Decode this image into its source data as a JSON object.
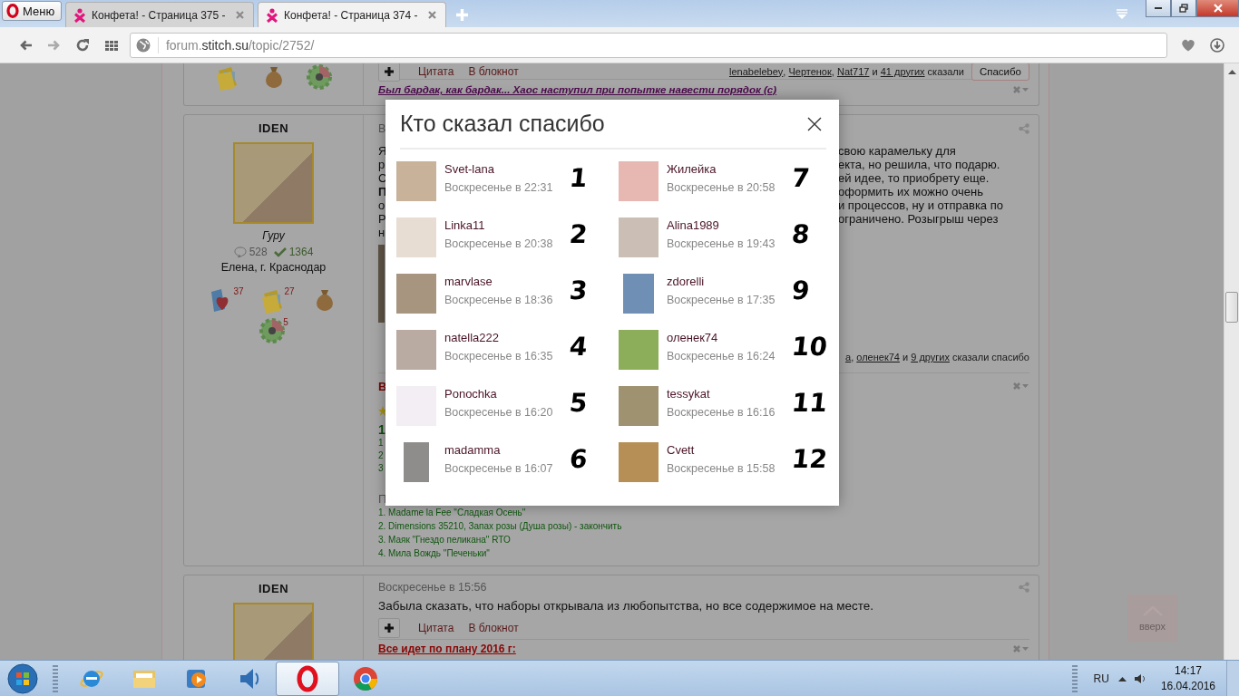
{
  "browser": {
    "menu_label": "Меню",
    "tabs": [
      {
        "title": "Конфета! - Страница 375 -",
        "selected": false
      },
      {
        "title": "Конфета! - Страница 374 -",
        "selected": true
      }
    ],
    "url": [
      {
        "kind": "dim",
        "text": "forum."
      },
      {
        "kind": "host",
        "text": "stitch.su"
      },
      {
        "kind": "dim",
        "text": "/topic/2752/"
      }
    ]
  },
  "post_top": {
    "awards": [
      {
        "kind": "folder"
      },
      {
        "kind": "bag"
      },
      {
        "kind": "gear"
      }
    ],
    "actions": [
      "Цитата",
      "В блокнот"
    ],
    "thanks": [
      {
        "kind": "link",
        "text": "lenabelebey"
      },
      {
        "kind": "plain",
        "text": ", "
      },
      {
        "kind": "link",
        "text": "Чертенок"
      },
      {
        "kind": "plain",
        "text": ", "
      },
      {
        "kind": "link",
        "text": "Nat717"
      },
      {
        "kind": "plain",
        "text": " и "
      },
      {
        "kind": "link",
        "text": "41 других"
      },
      {
        "kind": "plain",
        "text": " сказали"
      }
    ],
    "thanks_button": "Спасибо",
    "signature": "Был бардак, как бардак... Хаос наступил при попытке навести порядок (с)"
  },
  "post_main": {
    "author": "IDEN",
    "rank": "Гуру",
    "comments": "528",
    "thanks_count": "1364",
    "location": "Елена, г. Краснодар",
    "awards": [
      {
        "kind": "heart",
        "count": "37"
      },
      {
        "kind": "folder",
        "count": "27"
      },
      {
        "kind": "bag"
      },
      {
        "kind": "gear",
        "count": "5"
      }
    ],
    "date_fragment": "В",
    "body_left": [
      {
        "text": "Я",
        "bold": false
      },
      {
        "text": "р",
        "bold": false
      },
      {
        "text": "С",
        "bold": false
      },
      {
        "text": "П",
        "bold": true
      },
      {
        "text": "о",
        "bold": false
      },
      {
        "text": "Р",
        "bold": false
      },
      {
        "text": "н",
        "bold": false
      }
    ],
    "body_right": [
      "свою карамельку для",
      "екта, но решила, что подарю.",
      "ей идее, то приобрету еще.",
      "оформить их можно очень",
      "и процессов, ну и отправка по",
      "ограничено. Розыгрыш через"
    ],
    "thanks": [
      {
        "kind": "link",
        "text": "а"
      },
      {
        "kind": "plain",
        "text": ", "
      },
      {
        "kind": "link",
        "text": "оленек74"
      },
      {
        "kind": "plain",
        "text": " и "
      },
      {
        "kind": "link",
        "text": "9 других"
      },
      {
        "kind": "plain",
        "text": " сказали спасибо"
      }
    ],
    "signature": {
      "heading_fragment": "В",
      "list_heading_fragment": "1",
      "list_fragments": [
        "1",
        "2",
        "3"
      ],
      "second_heading_fragment": "П",
      "items": [
        "1. Madame la Fee \"Сладкая Осень\"",
        "2. Dimensions 35210, Запах розы (Душа розы) - закончить",
        "3. Маяк \"Гнездо пеликана\" RTO",
        "4. Мила Вождь \"Печеньки\""
      ]
    }
  },
  "post_bottom": {
    "author": "IDEN",
    "date": "Воскресенье в 15:56",
    "body": "Забыла сказать, что наборы открывала из любопытства, но все содержимое на месте.",
    "actions": [
      "Цитата",
      "В блокнот"
    ],
    "signature_heading": "Все идет по плану 2016 г:"
  },
  "scroll_top_label": "вверх",
  "modal": {
    "title": "Кто сказал спасибо",
    "users": [
      {
        "name": "Svet-lana",
        "time": "Воскресенье в 22:31",
        "mark": "1"
      },
      {
        "name": "Linka11",
        "time": "Воскресенье в 20:38",
        "mark": "2"
      },
      {
        "name": "marvlase",
        "time": "Воскресенье в 18:36",
        "mark": "3"
      },
      {
        "name": "natella222",
        "time": "Воскресенье в 16:35",
        "mark": "4"
      },
      {
        "name": "Ponochka",
        "time": "Воскресенье в 16:20",
        "mark": "5"
      },
      {
        "name": "madamma",
        "time": "Воскресенье в 16:07",
        "mark": "6"
      },
      {
        "name": "Жилейка",
        "time": "Воскресенье в 20:58",
        "mark": "7"
      },
      {
        "name": "Alina1989",
        "time": "Воскресенье в 19:43",
        "mark": "8"
      },
      {
        "name": "zdorelli",
        "time": "Воскресенье в 17:35",
        "mark": "9"
      },
      {
        "name": "оленек74",
        "time": "Воскресенье в 16:24",
        "mark": "10"
      },
      {
        "name": "tessykat",
        "time": "Воскресенье в 16:16",
        "mark": "11"
      },
      {
        "name": "Cvett",
        "time": "Воскресенье в 15:58",
        "mark": "12"
      }
    ]
  },
  "taskbar": {
    "apps": [
      {
        "kind": "ie",
        "selected": false
      },
      {
        "kind": "folder",
        "selected": false
      },
      {
        "kind": "media",
        "selected": false
      },
      {
        "kind": "sound",
        "selected": false
      },
      {
        "kind": "opera",
        "selected": true
      },
      {
        "kind": "chrome",
        "selected": false
      }
    ],
    "language": "RU",
    "time": "14:17",
    "date": "16.04.2016"
  }
}
